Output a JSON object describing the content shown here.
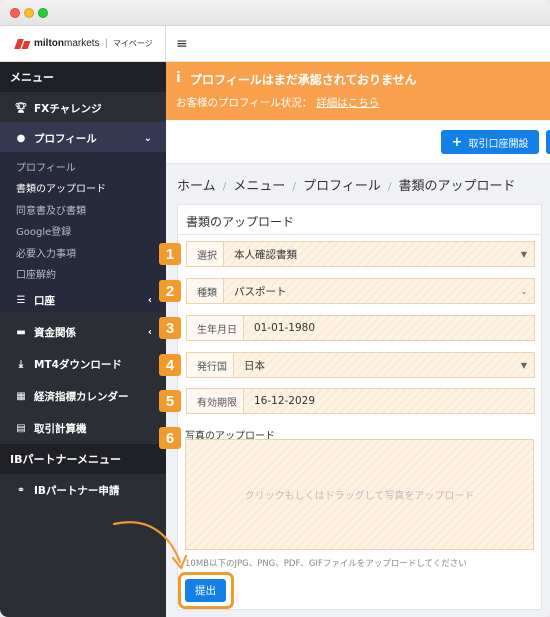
{
  "brand": {
    "name_bold": "milton",
    "name_light": "markets",
    "separator": "|",
    "mypage": "マイページ"
  },
  "sidebar": {
    "menu_header": "メニュー",
    "items": [
      {
        "label": "FXチャレンジ",
        "icon": "trophy-icon"
      },
      {
        "label": "プロフィール",
        "icon": "user-icon",
        "caret": "⌄"
      },
      {
        "label": "口座",
        "icon": "list-icon",
        "caret": "‹"
      },
      {
        "label": "資金関係",
        "icon": "wallet-icon",
        "caret": "‹"
      },
      {
        "label": "MT4ダウンロード",
        "icon": "download-icon"
      },
      {
        "label": "経済指標カレンダー",
        "icon": "calendar-icon"
      },
      {
        "label": "取引計算機",
        "icon": "calculator-icon"
      }
    ],
    "profile_submenu": [
      "プロフィール",
      "書類のアップロード",
      "同意書及び書類",
      "Google登録",
      "必要入力事項",
      "口座解約"
    ],
    "ib_header": "IBパートナーメニュー",
    "ib_item": {
      "label": "IBパートナー申請",
      "icon": "handshake-icon"
    }
  },
  "alert": {
    "icon": "i",
    "title": "プロフィールはまだ承認されておりません",
    "status_text": "お客様のプロフィール状況：",
    "link_text": "詳細はこちら",
    "color": "#f9a04c"
  },
  "actions": {
    "open_account": "取引口座開設",
    "plus": "+"
  },
  "breadcrumb": [
    "ホーム",
    "メニュー",
    "プロフィール",
    "書類のアップロード"
  ],
  "breadcrumb_sep": "/",
  "form": {
    "title": "書類のアップロード",
    "fields": [
      {
        "num": "1",
        "label": "選択",
        "value": "本人確認書類",
        "dropdown": true
      },
      {
        "num": "2",
        "label": "種類",
        "value": "パスポート",
        "dropdown": true
      },
      {
        "num": "3",
        "label": "生年月日",
        "value": "01-01-1980",
        "dropdown": false
      },
      {
        "num": "4",
        "label": "発行国",
        "value": "日本",
        "dropdown": true
      },
      {
        "num": "5",
        "label": "有効期限",
        "value": "16-12-2029",
        "dropdown": false
      }
    ],
    "photo_num": "6",
    "photo_label": "写真のアップロード",
    "drop_placeholder": "クリックもしくはドラッグして写真をアップロード",
    "help": "10MB以下のJPG、PNG、PDF、GIFファイルをアップロードしてください",
    "submit": "提出"
  },
  "colors": {
    "accent": "#1280e6",
    "badge": "#f39a2c",
    "sidebar": "#2b2e35"
  }
}
